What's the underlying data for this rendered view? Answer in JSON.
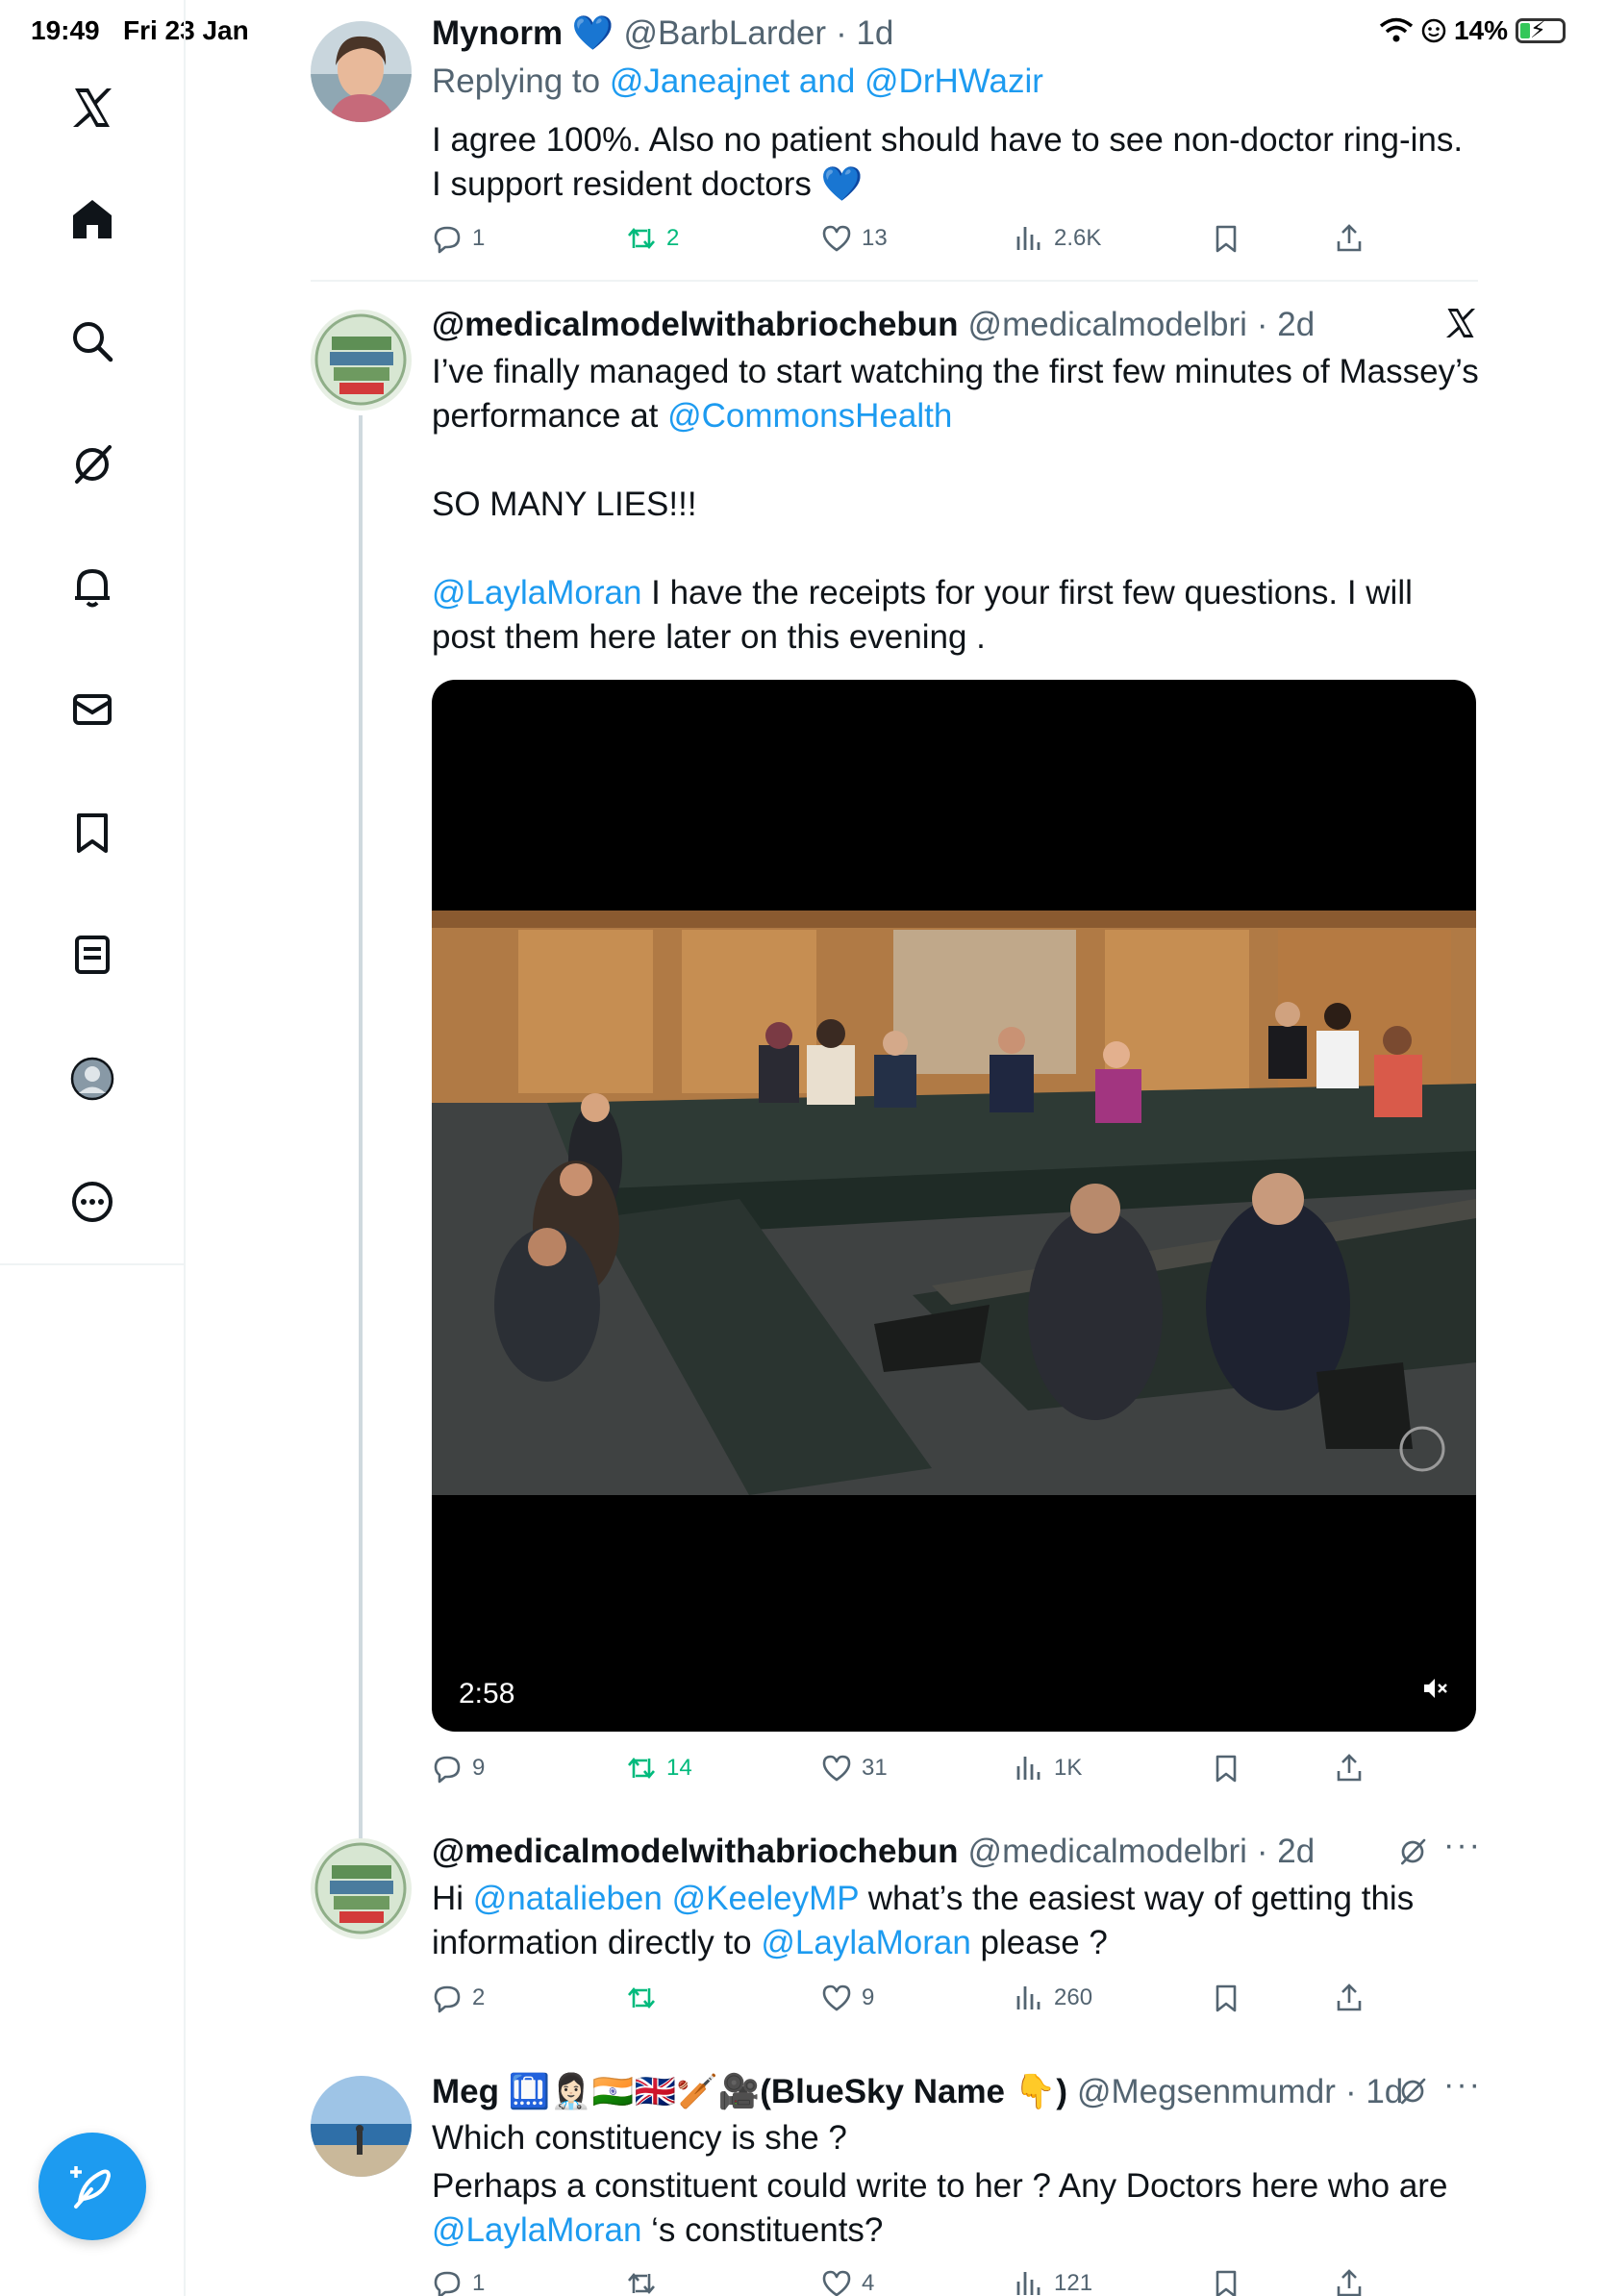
{
  "status_bar": {
    "time": "19:49",
    "date": "Fri 23 Jan",
    "battery": "14%"
  },
  "sidebar": {
    "items": [
      {
        "icon": "x-logo-icon"
      },
      {
        "icon": "home-icon"
      },
      {
        "icon": "search-icon"
      },
      {
        "icon": "grok-icon"
      },
      {
        "icon": "notifications-icon"
      },
      {
        "icon": "messages-icon"
      },
      {
        "icon": "bookmarks-icon"
      },
      {
        "icon": "lists-icon"
      },
      {
        "icon": "profile-icon"
      },
      {
        "icon": "more-icon"
      }
    ],
    "compose_icon": "compose-icon"
  },
  "tweets": [
    {
      "name": "Mynorm 💙",
      "handle": "@BarbLarder",
      "time": "· 1d",
      "replying_label": "Replying to",
      "replying_to": "@Janeajnet and @DrHWazir",
      "text": "I agree 100%. Also no patient should have to see non-doctor ring-ins. I support resident doctors 💙",
      "stats": {
        "replies": "1",
        "reposts": "2",
        "likes": "13",
        "views": "2.6K"
      }
    },
    {
      "name": "@medicalmodelwithabriochebun",
      "handle": "@medicalmodelbri",
      "time": "· 2d",
      "text_1a": "I’ve finally managed to start watching the first few minutes of Massey’s performance at ",
      "mention_1": "@CommonsHealth",
      "text_2": "SO MANY LIES!!!",
      "mention_2": "@LaylaMoran",
      "text_3": " I have the receipts for your first few questions. I will post them here later on this evening .",
      "video_duration": "2:58",
      "stats": {
        "replies": "9",
        "reposts": "14",
        "likes": "31",
        "views": "1K"
      }
    },
    {
      "name": "@medicalmodelwithabriochebun",
      "handle": "@medicalmodelbri",
      "time": "· 2d",
      "text_a": "Hi ",
      "mention_a": "@natalieben",
      "mention_b": "@KeeleyMP",
      "text_b": "  what’s the easiest way of getting this information directly to ",
      "mention_c": "@LaylaMoran",
      "text_c": " please ?",
      "stats": {
        "replies": "2",
        "reposts": "",
        "likes": "9",
        "views": "260"
      }
    },
    {
      "name": "Meg 🛄👩🏻‍⚕️🇮🇳🇬🇧🏏🎥(BlueSky Name 👇)",
      "handle": "@Megsenmumdr",
      "time": "· 1d",
      "text_a": "Which constituency is she ?",
      "text_b": "Perhaps a constituent could write to her ? Any Doctors here who are",
      "mention": "@LaylaMoran",
      "text_c": " ‘s constituents?",
      "stats": {
        "replies": "1",
        "reposts": "",
        "likes": "4",
        "views": "121"
      }
    }
  ],
  "colors": {
    "accent": "#1d9bf0",
    "repost": "#00ba7c",
    "muted": "#536471",
    "text": "#0f1419"
  }
}
